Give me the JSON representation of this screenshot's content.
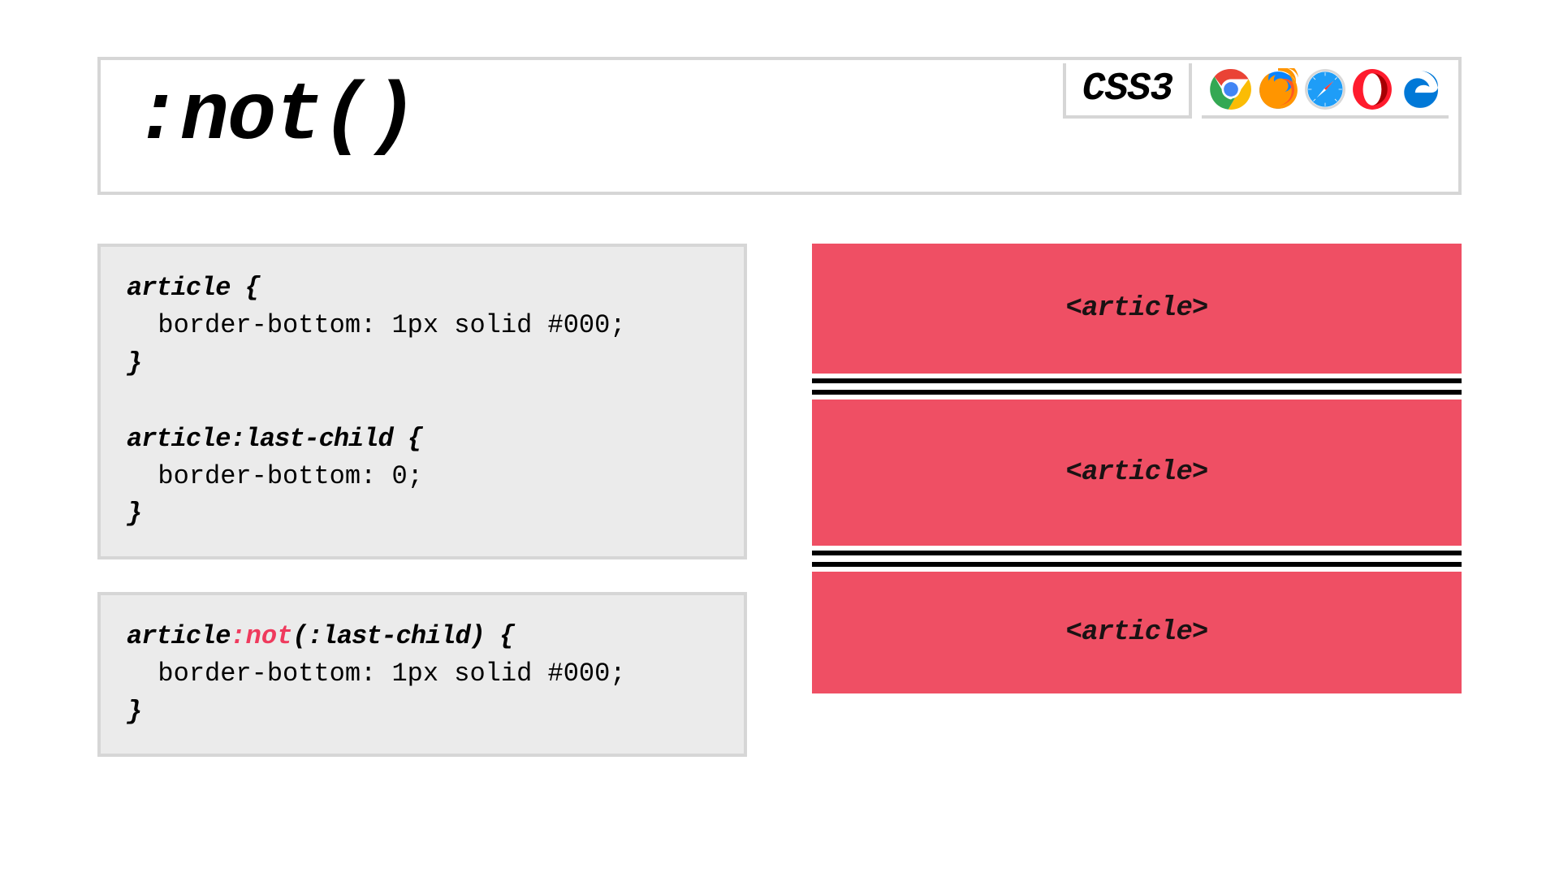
{
  "title": ":not()",
  "css_version": "CSS3",
  "browsers": [
    "chrome",
    "firefox",
    "safari",
    "opera",
    "edge"
  ],
  "code1": {
    "sel1": "article",
    "brace_open": " {",
    "decl1": "  border-bottom: 1px solid #000;",
    "brace_close": "}",
    "blank": "",
    "sel2": "article:last-child",
    "decl2": "  border-bottom: 0;"
  },
  "code2": {
    "sel_pre": "article",
    "sel_not": ":not",
    "sel_post": "(:last-child)",
    "brace_open": " {",
    "decl": "  border-bottom: 1px solid #000;",
    "brace_close": "}"
  },
  "demo": {
    "label": "<article>"
  },
  "colors": {
    "accent": "#ef4f64",
    "highlight": "#ef3a5d",
    "panel": "#ebebeb",
    "border": "#d6d6d6"
  }
}
